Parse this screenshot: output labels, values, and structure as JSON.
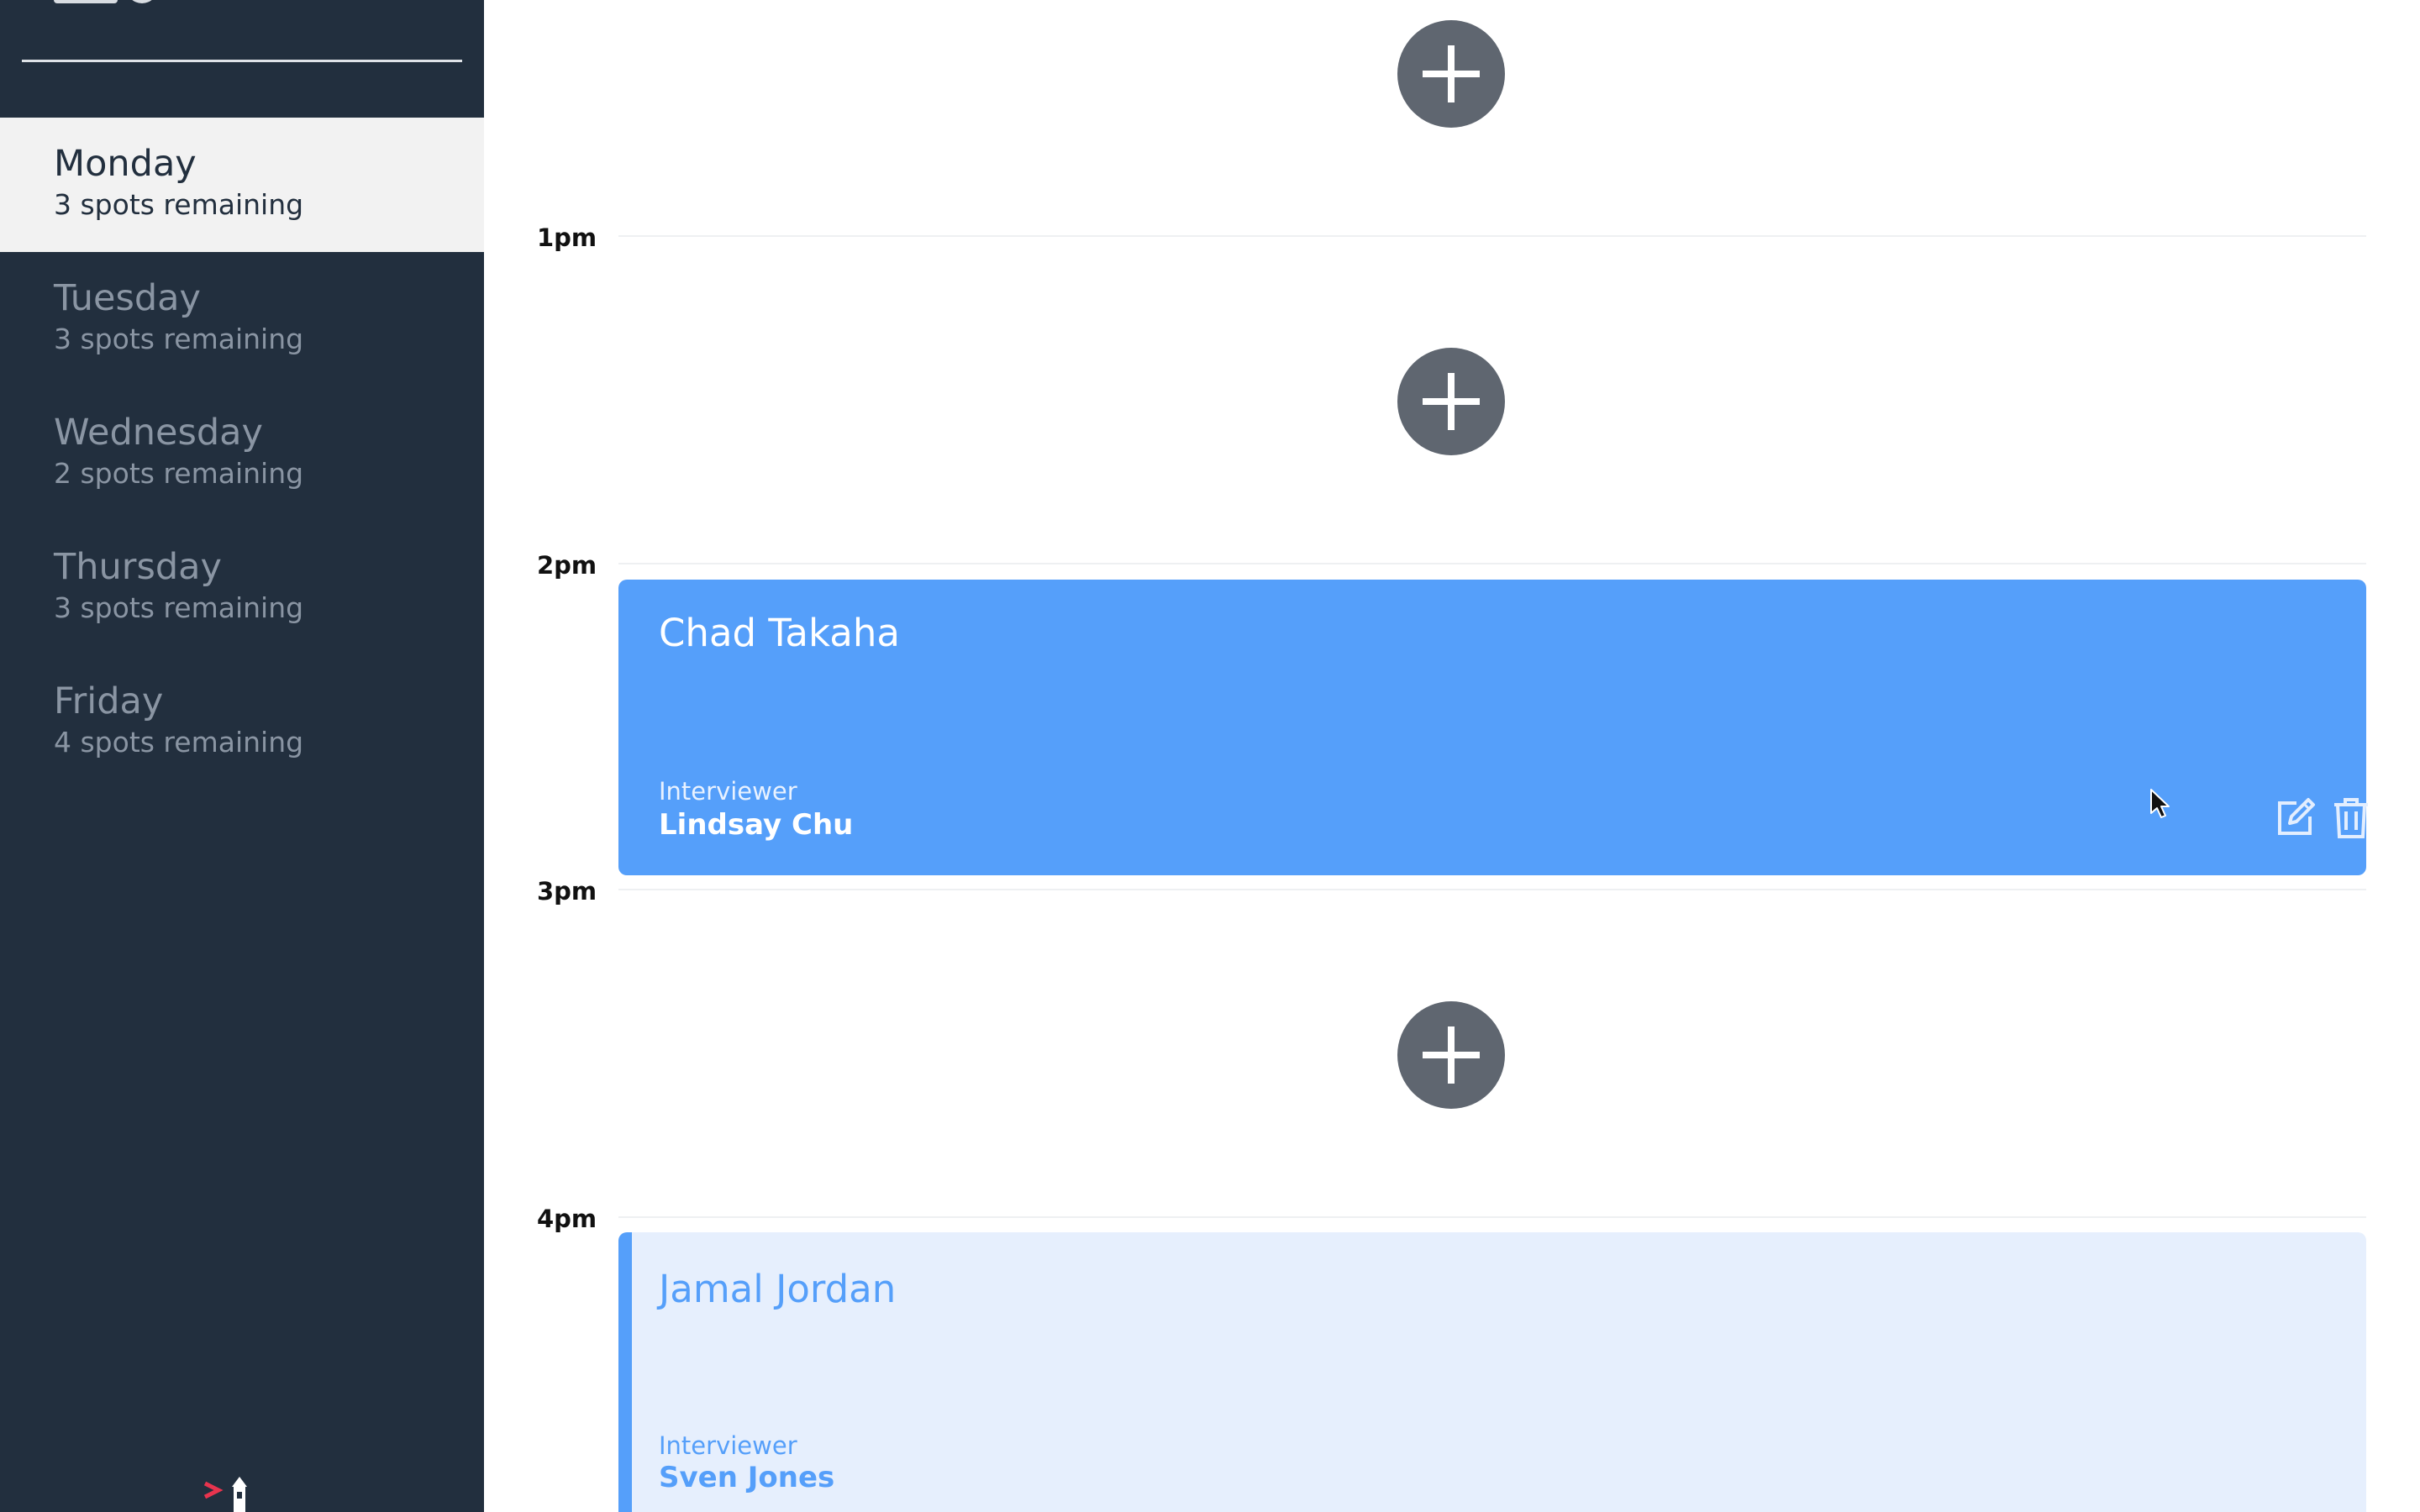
{
  "sidebar": {
    "days": [
      {
        "name": "Monday",
        "spots": "3 spots remaining",
        "selected": true
      },
      {
        "name": "Tuesday",
        "spots": "3 spots remaining",
        "selected": false
      },
      {
        "name": "Wednesday",
        "spots": "2 spots remaining",
        "selected": false
      },
      {
        "name": "Thursday",
        "spots": "3 spots remaining",
        "selected": false
      },
      {
        "name": "Friday",
        "spots": "4 spots remaining",
        "selected": false
      }
    ]
  },
  "schedule": {
    "times": [
      "1pm",
      "2pm",
      "3pm",
      "4pm"
    ],
    "appointments": [
      {
        "student": "Chad Takaha",
        "interviewer_label": "Interviewer",
        "interviewer": "Lindsay Chu"
      },
      {
        "student": "Jamal Jordan",
        "interviewer_label": "Interviewer",
        "interviewer": "Sven Jones"
      }
    ]
  },
  "icons": {
    "add": "plus-icon",
    "edit": "edit-icon",
    "delete": "trash-icon",
    "cursor": "mouse-pointer-icon",
    "brand": "lighthouse-icon"
  },
  "colors": {
    "sidebar_bg": "#222f3e",
    "selected_bg": "#f2f2f2",
    "add_button": "#5f6670",
    "appointment_blue": "#559ffa",
    "highlight_bg": "#e6effd",
    "brand_red": "#e8344e"
  }
}
